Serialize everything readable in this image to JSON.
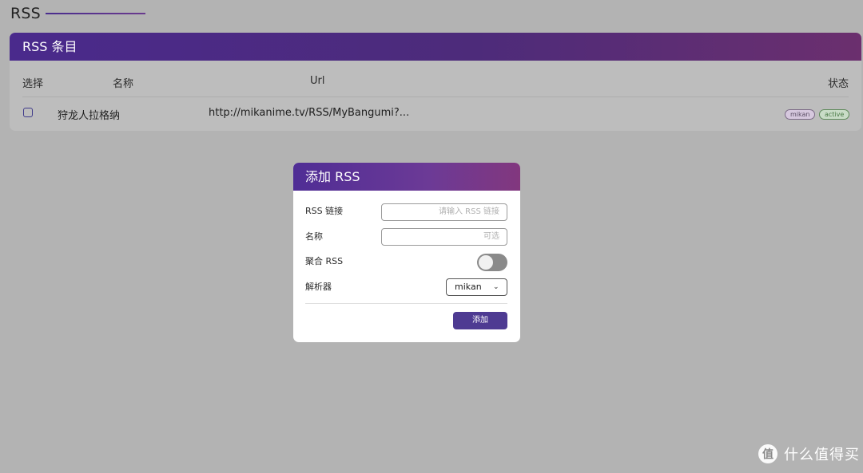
{
  "page": {
    "title": "RSS"
  },
  "card": {
    "title": "RSS 条目",
    "columns": {
      "select": "选择",
      "name": "名称",
      "url": "Url",
      "status": "状态"
    },
    "rows": [
      {
        "checked": false,
        "name": "狩龙人拉格纳",
        "url": "http://mikanime.tv/RSS/MyBangumi?...",
        "tags": [
          "mikan",
          "active"
        ]
      }
    ]
  },
  "dialog": {
    "title": "添加 RSS",
    "fields": {
      "link_label": "RSS 链接",
      "link_placeholder": "请输入 RSS 链接",
      "name_label": "名称",
      "name_placeholder": "可选",
      "aggregate_label": "聚合 RSS",
      "aggregate_on": false,
      "parser_label": "解析器",
      "parser_value": "mikan"
    },
    "submit_label": "添加"
  },
  "watermark": {
    "icon": "值",
    "text": "什么值得买"
  },
  "colors": {
    "accent": "#4e3b92",
    "header_gradient_start": "#4a2a8c",
    "header_gradient_end": "#6b2f6e",
    "background": "#b3b3b3"
  }
}
